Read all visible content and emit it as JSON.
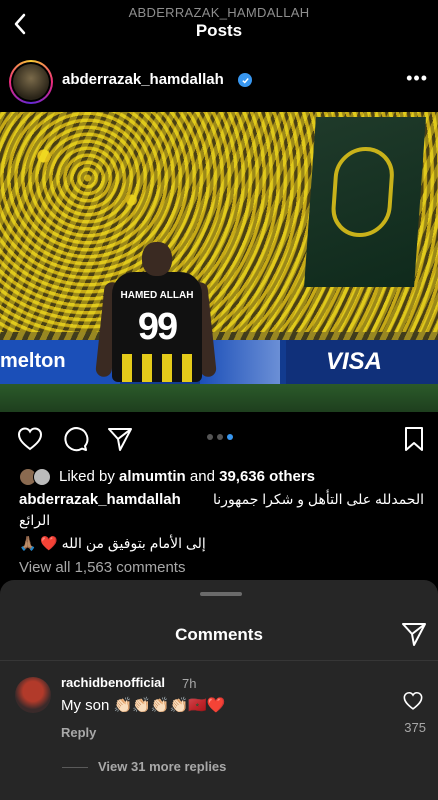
{
  "topbar": {
    "subtitle": "ABDERRAZAK_HAMDALLAH",
    "title": "Posts"
  },
  "post": {
    "username": "abderrazak_hamdallah",
    "verified": true,
    "more_icon": "more-horizontal-icon",
    "image": {
      "jersey_name": "HAMED ALLAH",
      "jersey_number": "99",
      "board_left": "melton",
      "board_right": "VISA"
    },
    "carousel": {
      "count": 3,
      "active_index": 2
    },
    "likes": {
      "prefix": "Liked by",
      "user": "almumtin",
      "middle": "and",
      "others": "39,636 others"
    },
    "caption": {
      "user": "abderrazak_hamdallah",
      "line1": "الحمدلله على التأهل و شكرا جمهورنا",
      "line2": "الرائع",
      "line3": "إلى الأمام بتوفيق من الله ❤️ 🙏🏽"
    },
    "view_all": "View all 1,563 comments"
  },
  "comments_sheet": {
    "title": "Comments",
    "comment": {
      "user": "rachidbenofficial",
      "time": "7h",
      "text": "My son 👏🏻👏🏻👏🏻👏🏻🇲🇦❤️",
      "reply": "Reply",
      "likes": "375",
      "more_replies": "View 31 more replies"
    }
  },
  "colors": {
    "accent": "#3897f0",
    "sheet_bg": "#262626",
    "muted": "#a8a8a8"
  }
}
